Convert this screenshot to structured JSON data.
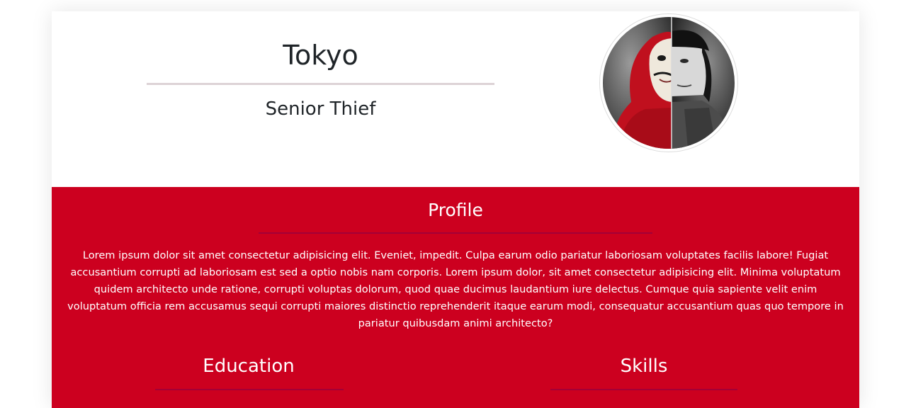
{
  "header": {
    "name": "Tokyo",
    "role": "Senior Thief"
  },
  "avatar": {
    "alt_semantic": "portrait-half-mask"
  },
  "profile": {
    "title": "Profile",
    "text": "Lorem ipsum dolor sit amet consectetur adipisicing elit. Eveniet, impedit. Culpa earum odio pariatur laboriosam voluptates facilis labore! Fugiat accusantium corrupti ad laboriosam est sed a optio nobis nam corporis. Lorem ipsum dolor, sit amet consectetur adipisicing elit. Minima voluptatum quidem architecto unde ratione, corrupti voluptas dolorum, quod quae ducimus laudantium iure delectus. Cumque quia sapiente velit enim voluptatum officia rem accusamus sequi corrupti maiores distinctio reprehenderit itaque earum modi, consequatur accusantium quas quo tempore in pariatur quibusdam animi architecto?"
  },
  "education": {
    "title": "Education"
  },
  "skills": {
    "title": "Skills"
  },
  "colors": {
    "accent": "#cc001f",
    "rule_dark": "#a30037",
    "heading_text": "#1f2428"
  }
}
